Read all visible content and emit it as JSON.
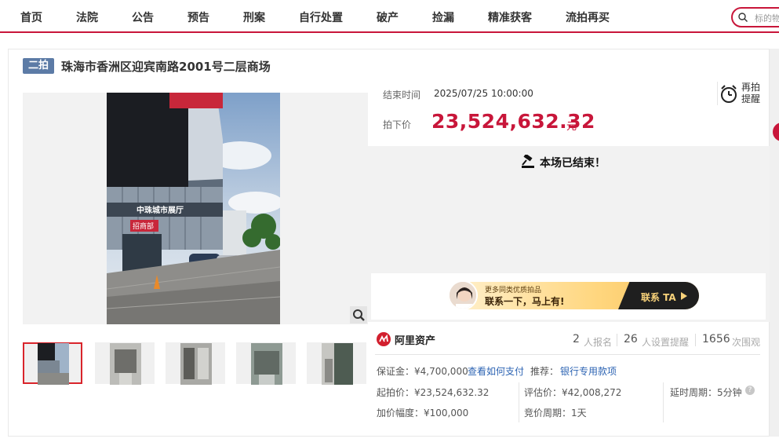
{
  "nav": {
    "items": [
      "首页",
      "法院",
      "公告",
      "预告",
      "刑案",
      "自行处置",
      "破产",
      "捡漏",
      "精准获客",
      "流拍再买"
    ],
    "search_placeholder": "标的物"
  },
  "listing": {
    "round_badge": "二拍",
    "title": "珠海市香洲区迎宾南路2001号二层商场",
    "photo_sign_text": "中珠城市展厅",
    "photo_banner_text": "招商部"
  },
  "auction": {
    "end_label": "结束时间",
    "end_value": "2025/07/25 10:00:00",
    "remind_label": "再拍提醒",
    "price_label": "拍下价",
    "price_value": "23,524,632.32",
    "price_unit": "元",
    "ended_text": "本场已结束！"
  },
  "promo": {
    "small_text": "更多同类优质拍品",
    "big_text": "联系一下，马上有!",
    "button_label": "联系 TA"
  },
  "stats": {
    "brand": "阿里资产",
    "signup_count": "2",
    "signup_label": "人报名",
    "remind_count": "26",
    "remind_label": "人设置提醒",
    "view_count": "1656",
    "view_label": "次围观"
  },
  "details": {
    "deposit": "保证金：¥4,700,000",
    "deposit_link": "查看如何支付",
    "recommend_label": "推荐：",
    "recommend_link": "银行专用款项",
    "start_price": "起拍价：¥23,524,632.32",
    "eval_price": "评估价：¥42,008,272",
    "delay": "延时周期：5分钟",
    "increment": "加价幅度：¥100,000",
    "bid_cycle": "竞价周期：1天"
  },
  "colors": {
    "brand_red": "#c8163a",
    "badge_blue": "#5c7ba6",
    "link_blue": "#2d64b3"
  }
}
